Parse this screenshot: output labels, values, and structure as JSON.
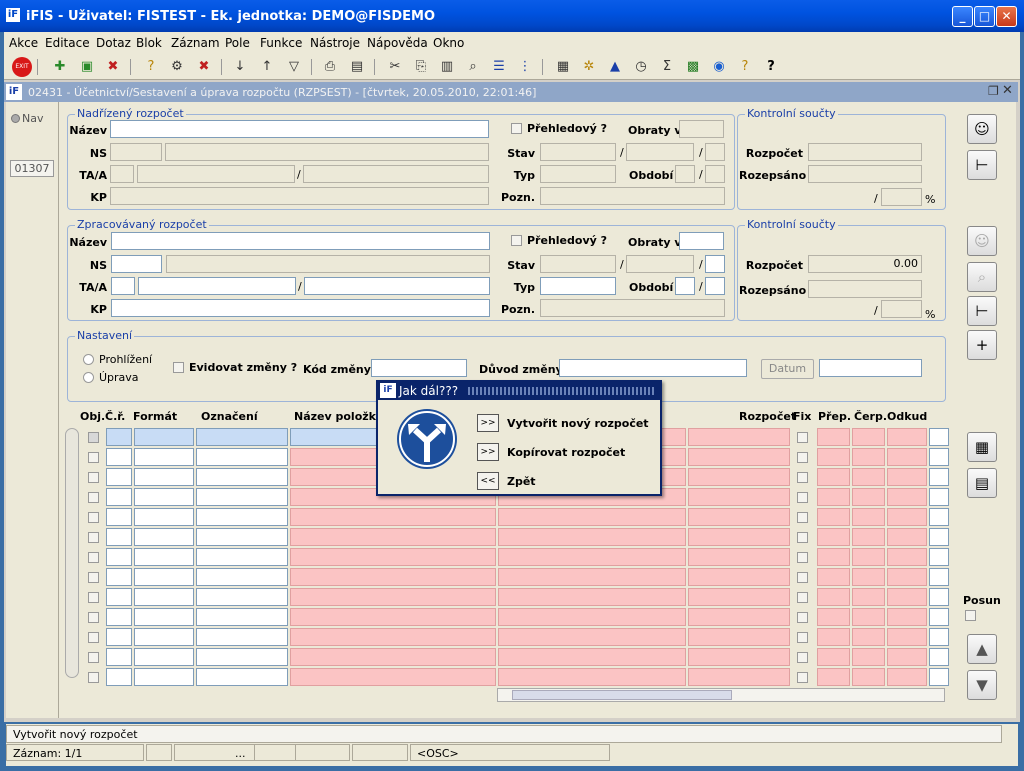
{
  "window": {
    "title": "iFIS - Uživatel: FISTEST - Ek. jednotka: DEMO@FISDEMO",
    "minimize": "_",
    "maximize": "□",
    "close": "✕"
  },
  "menu": [
    "Akce",
    "Editace",
    "Dotaz",
    "Blok",
    "Záznam",
    "Pole",
    "Funkce",
    "Nástroje",
    "Nápověda",
    "Okno"
  ],
  "form_title": "02431 - Účetnictví/Sestavení a úprava rozpočtu (RZPSEST) - [čtvrtek, 20.05.2010, 22:01:46]",
  "left": {
    "nav": "Nav",
    "code": "01307"
  },
  "nadrizeny": {
    "legend": "Nadřízený rozpočet",
    "labels": {
      "nazev": "Název",
      "ns": "NS",
      "taa": "TA/A",
      "kp": "KP",
      "prehledovy": "Přehledový ?",
      "obraty": "Obraty v",
      "stav": "Stav",
      "typ": "Typ",
      "obdobi": "Období",
      "pozn": "Pozn."
    },
    "slash": "/"
  },
  "kontrol1": {
    "legend": "Kontrolní součty",
    "rozpocet": "Rozpočet",
    "rozepsano": "Rozepsáno",
    "pct": "%",
    "slash": "/"
  },
  "zpracovavany": {
    "legend": "Zpracovávaný rozpočet",
    "labels": {
      "nazev": "Název",
      "ns": "NS",
      "taa": "TA/A",
      "kp": "KP",
      "prehledovy": "Přehledový ?",
      "obraty": "Obraty v",
      "stav": "Stav",
      "typ": "Typ",
      "obdobi": "Období",
      "pozn": "Pozn."
    },
    "slash": "/"
  },
  "kontrol2": {
    "legend": "Kontrolní součty",
    "rozpocet": "Rozpočet",
    "rozpocet_value": "0.00",
    "rozepsano": "Rozepsáno",
    "pct": "%",
    "slash": "/"
  },
  "nastaveni": {
    "legend": "Nastavení",
    "prohlizeni": "Prohlížení",
    "uprava": "Úprava",
    "evidovat": "Evidovat změny ?",
    "kod": "Kód změny",
    "duvod": "Důvod změny",
    "datum": "Datum"
  },
  "grid": {
    "headers": {
      "obj": "Obj.",
      "cr": "Č.ř.",
      "format": "Formát",
      "oznaceni": "Označení",
      "nazev": "Název položky",
      "rozpocet": "Rozpočet",
      "fix": "Fix",
      "prep": "Přep.",
      "cerp": "Čerp.",
      "odkud": "Odkud"
    },
    "rows": 13
  },
  "right": {
    "posun": "Posun"
  },
  "dialog": {
    "title": "Jak dál???",
    "opt1_btn": ">>",
    "opt1": "Vytvořit nový rozpočet",
    "opt2_btn": ">>",
    "opt2": "Kopírovat rozpočet",
    "opt3_btn": "<<",
    "opt3": "Zpět"
  },
  "status": {
    "message": "Vytvořit nový rozpočet",
    "zaznam": "Záznam: 1/1",
    "dots": "...",
    "osc": "<OSC>"
  }
}
